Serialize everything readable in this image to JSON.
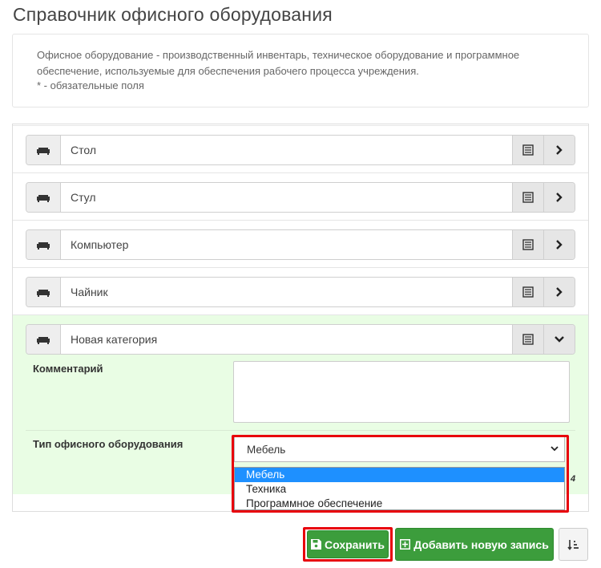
{
  "page": {
    "title": "Справочник офисного оборудования",
    "description": "Офисное оборудование - производственный инвентарь, техническое оборудование и программное обеспечение, используемые для обеспечения рабочего процесса учреждения.",
    "required_note": "* - обязательные поля"
  },
  "categories": [
    {
      "label": "Стол"
    },
    {
      "label": "Стул"
    },
    {
      "label": "Компьютер"
    },
    {
      "label": "Чайник"
    },
    {
      "label": "Новая категория"
    }
  ],
  "detail": {
    "comment_label": "Комментарий",
    "comment_value": "",
    "type_label": "Тип офисного оборудования",
    "type_selected": "Мебель",
    "type_options": [
      "Мебель",
      "Техника",
      "Программное обеспечение"
    ],
    "char_count": "4"
  },
  "actions": {
    "save_label": "Сохранить",
    "add_label": "Добавить новую запись"
  },
  "colors": {
    "accent_green": "#3c9d3c",
    "active_row_bg": "#e9fde4",
    "highlight_red": "#e8000b",
    "selected_option": "#1e90ff"
  }
}
